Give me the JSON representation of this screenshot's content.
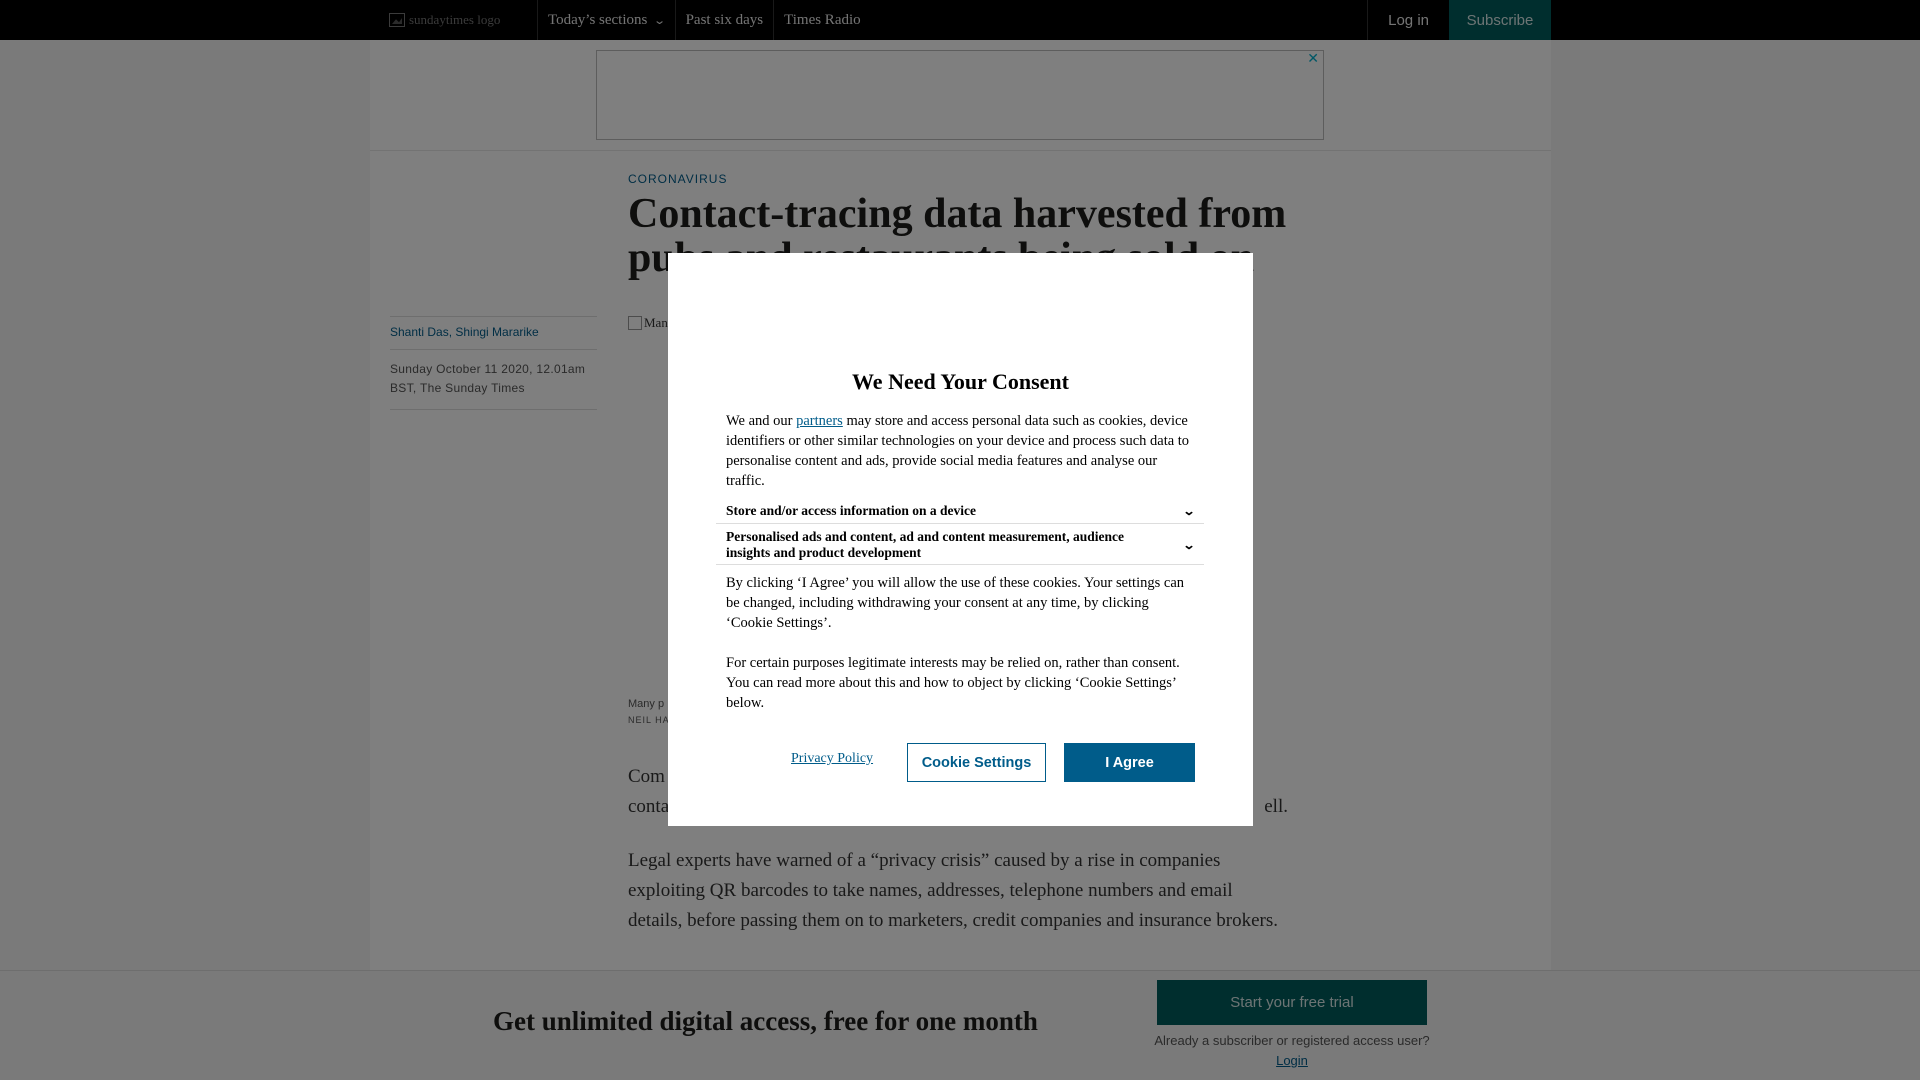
{
  "nav": {
    "logo_alt": "sundaytimes logo",
    "items": [
      {
        "label": "Today’s sections",
        "icon": "chevron-down-icon"
      },
      {
        "label": "Past six days"
      },
      {
        "label": "Times Radio"
      }
    ],
    "login_label": "Log in",
    "subscribe_label": "Subscribe"
  },
  "ad": {
    "close_glyph": "✕"
  },
  "article": {
    "section": "CORONAVIRUS",
    "headline": "Contact-tracing data harvested from pubs and restaurants being sold on",
    "authors": "Shanti Das, Shingi Mararike",
    "dateline": "Sunday October 11 2020, 12.01am BST, The Sunday Times",
    "image_alt": "Man",
    "caption": "Many p",
    "credit": "NEIL HA",
    "para1_start": "Com",
    "para1_line2_start": "conta",
    "para1_tail": "ell.",
    "para2": "Legal experts have warned of a “privacy crisis” caused by a rise in companies exploiting QR barcodes to take names, addresses, telephone numbers and email details, before passing them on to marketers, credit companies and insurance brokers."
  },
  "promo": {
    "title": "Get unlimited digital access, free for one month",
    "cta": "Start your free trial",
    "note_prefix": "Already a subscriber or registered access user?",
    "note_link": "Login"
  },
  "consent": {
    "title": "We Need Your Consent",
    "intro_before_link": "We and our ",
    "intro_link": "partners",
    "intro_after_link": " may store and access personal data such as cookies, device identifiers or other similar technologies on your device and process such data to personalise content and ads, provide social media features and analyse our traffic.",
    "purposes": [
      {
        "label": "Store and/or access information on a device",
        "icon": "chevron-down-icon"
      },
      {
        "label": "Personalised ads and content, ad and content measurement, audience insights and product development",
        "icon": "chevron-down-icon"
      }
    ],
    "para1": "By clicking ‘I Agree’ you will allow the use of these cookies. Your settings can be changed, including withdrawing your consent at any time, by clicking ‘Cookie Settings’.",
    "para2": "For certain purposes legitimate interests may be relied on, rather than consent. You can read more about this and how to object by clicking ‘Cookie Settings’ below.",
    "privacy_link": "Privacy Policy",
    "settings_button": "Cookie Settings",
    "agree_button": "I Agree"
  },
  "colors": {
    "brand_teal": "#005c5c",
    "link_blue": "#005c8a",
    "topbar": "#000000"
  }
}
